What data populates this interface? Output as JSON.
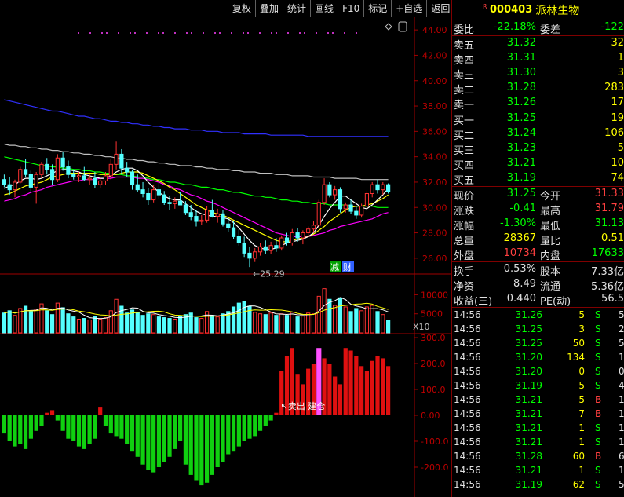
{
  "toolbar": [
    "复权",
    "叠加",
    "统计",
    "画线",
    "F10",
    "标记",
    "+自选",
    "返回"
  ],
  "stock": {
    "badge": "R",
    "code": "000403",
    "name": "派林生物"
  },
  "order_ratio": {
    "label": "委比",
    "value": "-22.18%",
    "label2": "委差",
    "value2": "-122"
  },
  "asks": [
    {
      "label": "卖五",
      "price": "31.32",
      "qty": "32"
    },
    {
      "label": "卖四",
      "price": "31.31",
      "qty": "1"
    },
    {
      "label": "卖三",
      "price": "31.30",
      "qty": "3"
    },
    {
      "label": "卖二",
      "price": "31.28",
      "qty": "283"
    },
    {
      "label": "卖一",
      "price": "31.26",
      "qty": "17"
    }
  ],
  "bids": [
    {
      "label": "买一",
      "price": "31.25",
      "qty": "19"
    },
    {
      "label": "买二",
      "price": "31.24",
      "qty": "106"
    },
    {
      "label": "买三",
      "price": "31.23",
      "qty": "5"
    },
    {
      "label": "买四",
      "price": "31.21",
      "qty": "10"
    },
    {
      "label": "买五",
      "price": "31.19",
      "qty": "74"
    }
  ],
  "quote": [
    {
      "l1": "现价",
      "v1": "31.25",
      "c1": "green",
      "l2": "今开",
      "v2": "31.33",
      "c2": "red"
    },
    {
      "l1": "涨跌",
      "v1": "-0.41",
      "c1": "green",
      "l2": "最高",
      "v2": "31.79",
      "c2": "red"
    },
    {
      "l1": "涨幅",
      "v1": "-1.30%",
      "c1": "green",
      "l2": "最低",
      "v2": "31.13",
      "c2": "green"
    },
    {
      "l1": "总量",
      "v1": "28367",
      "c1": "yellow",
      "l2": "量比",
      "v2": "0.51",
      "c2": "yellow"
    },
    {
      "l1": "外盘",
      "v1": "10734",
      "c1": "red",
      "l2": "内盘",
      "v2": "17633",
      "c2": "green"
    }
  ],
  "stats": [
    {
      "l1": "换手",
      "v1": "0.53%",
      "l2": "股本",
      "v2": "7.33亿"
    },
    {
      "l1": "净资",
      "v1": "8.49",
      "l2": "流通",
      "v2": "5.36亿"
    },
    {
      "l1": "收益(三)",
      "v1": "0.440",
      "l2": "PE(动)",
      "v2": "56.5"
    }
  ],
  "ticks": [
    {
      "time": "14:56",
      "price": "31.26",
      "vol": "5",
      "side": "S",
      "cnt": "5"
    },
    {
      "time": "14:56",
      "price": "31.25",
      "vol": "3",
      "side": "S",
      "cnt": "2"
    },
    {
      "time": "14:56",
      "price": "31.25",
      "vol": "50",
      "side": "S",
      "cnt": "5"
    },
    {
      "time": "14:56",
      "price": "31.20",
      "vol": "134",
      "side": "S",
      "cnt": "12"
    },
    {
      "time": "14:56",
      "price": "31.20",
      "vol": "0",
      "side": "S",
      "cnt": "0"
    },
    {
      "time": "14:56",
      "price": "31.19",
      "vol": "5",
      "side": "S",
      "cnt": "4"
    },
    {
      "time": "14:56",
      "price": "31.21",
      "vol": "5",
      "side": "B",
      "cnt": "1"
    },
    {
      "time": "14:56",
      "price": "31.21",
      "vol": "7",
      "side": "B",
      "cnt": "1"
    },
    {
      "time": "14:56",
      "price": "31.21",
      "vol": "1",
      "side": "S",
      "cnt": "1"
    },
    {
      "time": "14:56",
      "price": "31.21",
      "vol": "1",
      "side": "S",
      "cnt": "1"
    },
    {
      "time": "14:56",
      "price": "31.28",
      "vol": "60",
      "side": "B",
      "cnt": "6"
    },
    {
      "time": "14:56",
      "price": "31.21",
      "vol": "1",
      "side": "S",
      "cnt": "1"
    },
    {
      "time": "14:56",
      "price": "31.19",
      "vol": "62",
      "side": "S",
      "cnt": "5"
    }
  ],
  "chart_data": {
    "type": "candlestick",
    "price_axis": {
      "ticks": [
        "44.00",
        "42.00",
        "40.00",
        "38.00",
        "36.00",
        "34.00",
        "32.00",
        "30.00",
        "28.00",
        "26.00"
      ],
      "ylim": [
        25,
        45
      ]
    },
    "low_annotation": "25.29",
    "tags": [
      "减",
      "财"
    ],
    "volume_axis": {
      "ticks": [
        "10000",
        "5000"
      ],
      "unit": "X10",
      "ylim": [
        0,
        14000
      ]
    },
    "indicator_axis": {
      "ticks": [
        "300.0",
        "200.0",
        "100.0",
        "0.00",
        "-100.0",
        "-200.0"
      ],
      "ylim": [
        -300,
        300
      ]
    },
    "indicator_annotation": "卖出 建仓",
    "colors": {
      "up": "#ff3232",
      "down": "#54ffff",
      "ma5": "#ffffff",
      "ma10": "#ffff00",
      "ma20": "#ff00ff",
      "ma60": "#00ff00",
      "ma120": "#c0c0c0",
      "ma250": "#3030ff"
    },
    "candles": [
      [
        32.2,
        32.6,
        31.6,
        31.8
      ],
      [
        31.8,
        32.4,
        31.0,
        31.4
      ],
      [
        31.4,
        32.2,
        30.8,
        32.0
      ],
      [
        32.0,
        33.2,
        31.9,
        33.0
      ],
      [
        33.0,
        33.8,
        32.4,
        32.6
      ],
      [
        32.6,
        32.9,
        31.2,
        31.6
      ],
      [
        31.6,
        32.8,
        30.3,
        32.6
      ],
      [
        32.6,
        33.6,
        32.3,
        33.4
      ],
      [
        33.4,
        33.9,
        32.6,
        33.0
      ],
      [
        33.0,
        33.4,
        31.8,
        32.2
      ],
      [
        32.2,
        34.2,
        32.0,
        33.9
      ],
      [
        33.9,
        34.4,
        32.9,
        33.2
      ],
      [
        33.2,
        33.7,
        32.3,
        32.6
      ],
      [
        32.6,
        33.0,
        32.2,
        32.4
      ],
      [
        32.4,
        32.8,
        32.0,
        32.5
      ],
      [
        32.5,
        33.2,
        32.1,
        32.2
      ],
      [
        32.2,
        32.6,
        31.8,
        32.3
      ],
      [
        32.3,
        32.8,
        31.5,
        31.8
      ],
      [
        31.8,
        32.4,
        31.5,
        32.1
      ],
      [
        32.1,
        32.8,
        31.8,
        32.5
      ],
      [
        32.5,
        33.8,
        32.2,
        33.4
      ],
      [
        33.4,
        35.2,
        33.0,
        34.2
      ],
      [
        34.2,
        34.6,
        32.6,
        33.1
      ],
      [
        33.1,
        33.6,
        32.4,
        32.8
      ],
      [
        32.8,
        33.0,
        31.4,
        31.8
      ],
      [
        31.8,
        32.6,
        31.2,
        31.4
      ],
      [
        31.4,
        32.0,
        30.8,
        31.1
      ],
      [
        31.1,
        31.5,
        30.2,
        30.6
      ],
      [
        30.6,
        31.8,
        30.4,
        31.4
      ],
      [
        31.4,
        32.0,
        30.7,
        31.0
      ],
      [
        31.0,
        31.3,
        30.2,
        30.4
      ],
      [
        30.4,
        30.9,
        29.8,
        30.3
      ],
      [
        30.3,
        30.8,
        29.9,
        30.5
      ],
      [
        30.5,
        31.2,
        30.2,
        30.2
      ],
      [
        30.2,
        30.5,
        29.4,
        29.6
      ],
      [
        29.6,
        30.2,
        29.0,
        29.3
      ],
      [
        29.3,
        29.8,
        28.5,
        28.9
      ],
      [
        28.9,
        29.4,
        28.6,
        29.0
      ],
      [
        29.0,
        30.1,
        28.8,
        29.8
      ],
      [
        29.8,
        30.6,
        29.2,
        29.3
      ],
      [
        29.3,
        29.9,
        28.8,
        29.5
      ],
      [
        29.5,
        29.8,
        28.5,
        28.7
      ],
      [
        28.7,
        29.1,
        28.1,
        28.4
      ],
      [
        28.4,
        28.9,
        27.5,
        27.7
      ],
      [
        27.7,
        28.3,
        27.0,
        27.2
      ],
      [
        27.2,
        27.7,
        26.1,
        26.4
      ],
      [
        26.4,
        26.9,
        25.3,
        26.0
      ],
      [
        26.0,
        26.8,
        25.7,
        26.5
      ],
      [
        26.5,
        27.2,
        26.2,
        26.9
      ],
      [
        26.9,
        27.4,
        26.3,
        26.6
      ],
      [
        26.6,
        27.3,
        26.3,
        27.0
      ],
      [
        27.0,
        27.6,
        26.5,
        26.8
      ],
      [
        26.8,
        27.8,
        26.6,
        27.6
      ],
      [
        27.6,
        28.0,
        27.0,
        27.2
      ],
      [
        27.2,
        28.3,
        27.0,
        28.0
      ],
      [
        28.0,
        28.4,
        27.3,
        27.6
      ],
      [
        27.6,
        28.2,
        27.1,
        28.0
      ],
      [
        28.0,
        28.5,
        27.7,
        28.3
      ],
      [
        28.3,
        28.9,
        28.0,
        28.6
      ],
      [
        28.6,
        30.6,
        28.4,
        30.4
      ],
      [
        30.4,
        32.3,
        30.2,
        31.8
      ],
      [
        31.8,
        32.0,
        30.8,
        31.0
      ],
      [
        31.0,
        31.7,
        30.6,
        31.4
      ],
      [
        31.4,
        31.6,
        29.6,
        29.9
      ],
      [
        29.9,
        30.4,
        29.6,
        30.2
      ],
      [
        30.2,
        30.6,
        29.5,
        29.7
      ],
      [
        29.7,
        30.1,
        29.1,
        29.4
      ],
      [
        29.4,
        30.3,
        29.2,
        30.1
      ],
      [
        30.1,
        31.3,
        29.9,
        31.1
      ],
      [
        31.1,
        32.0,
        30.8,
        31.8
      ],
      [
        31.8,
        32.2,
        31.1,
        31.4
      ],
      [
        31.4,
        32.0,
        31.0,
        31.8
      ],
      [
        31.8,
        31.9,
        31.1,
        31.25
      ]
    ],
    "ma_lines": {
      "ma5": [
        31.5,
        31.7,
        31.8,
        32.1,
        32.3,
        32.3,
        32.2,
        32.3,
        32.5,
        32.7,
        32.9,
        33.0,
        33.0,
        32.9,
        32.8,
        32.6,
        32.5,
        32.4,
        32.3,
        32.3,
        32.5,
        32.8,
        33.0,
        33.1,
        33.1,
        32.9,
        32.5,
        32.0,
        31.6,
        31.2,
        30.9,
        30.7,
        30.6,
        30.6,
        30.3,
        30.0,
        29.7,
        29.5,
        29.4,
        29.3,
        29.3,
        29.2,
        29.1,
        28.8,
        28.4,
        27.9,
        27.4,
        27.0,
        26.8,
        26.7,
        26.7,
        26.8,
        27.0,
        27.2,
        27.3,
        27.4,
        27.5,
        27.7,
        28.0,
        28.6,
        29.3,
        29.9,
        30.4,
        30.9,
        30.9,
        30.6,
        30.3,
        30.0,
        29.9,
        30.2,
        30.6,
        31.0,
        31.5
      ],
      "ma10": [
        31.0,
        31.1,
        31.3,
        31.5,
        31.7,
        31.8,
        31.9,
        32.0,
        32.2,
        32.4,
        32.5,
        32.6,
        32.7,
        32.7,
        32.7,
        32.7,
        32.7,
        32.7,
        32.6,
        32.6,
        32.6,
        32.6,
        32.7,
        32.8,
        32.8,
        32.8,
        32.7,
        32.5,
        32.3,
        32.1,
        31.9,
        31.6,
        31.4,
        31.1,
        30.8,
        30.5,
        30.2,
        30.0,
        29.8,
        29.6,
        29.5,
        29.4,
        29.2,
        29.0,
        28.8,
        28.6,
        28.4,
        28.2,
        28.0,
        27.8,
        27.6,
        27.4,
        27.3,
        27.3,
        27.4,
        27.5,
        27.6,
        27.7,
        27.9,
        28.2,
        28.5,
        28.9,
        29.2,
        29.5,
        29.8,
        30.0,
        30.1,
        30.1,
        30.2,
        30.3,
        30.5,
        30.7,
        31.0
      ],
      "ma20": [
        30.5,
        30.6,
        30.7,
        30.9,
        31.0,
        31.2,
        31.3,
        31.4,
        31.6,
        31.7,
        31.8,
        31.9,
        32.0,
        32.1,
        32.1,
        32.2,
        32.2,
        32.2,
        32.3,
        32.3,
        32.3,
        32.4,
        32.4,
        32.4,
        32.4,
        32.3,
        32.3,
        32.2,
        32.1,
        32.0,
        31.8,
        31.7,
        31.5,
        31.4,
        31.2,
        31.0,
        30.9,
        30.7,
        30.5,
        30.4,
        30.2,
        30.0,
        29.8,
        29.6,
        29.4,
        29.2,
        29.0,
        28.8,
        28.6,
        28.4,
        28.2,
        28.0,
        27.9,
        27.8,
        27.7,
        27.7,
        27.7,
        27.7,
        27.8,
        27.9,
        28.0,
        28.2,
        28.3,
        28.5,
        28.6,
        28.7,
        28.8,
        28.9,
        29.0,
        29.1,
        29.3,
        29.5,
        29.6
      ],
      "ma60": [
        34.0,
        33.9,
        33.8,
        33.7,
        33.6,
        33.5,
        33.4,
        33.3,
        33.3,
        33.2,
        33.2,
        33.1,
        33.1,
        33.0,
        33.0,
        32.9,
        32.9,
        32.8,
        32.8,
        32.7,
        32.7,
        32.6,
        32.6,
        32.5,
        32.5,
        32.4,
        32.4,
        32.3,
        32.2,
        32.2,
        32.1,
        32.0,
        32.0,
        31.9,
        31.8,
        31.8,
        31.7,
        31.6,
        31.6,
        31.5,
        31.4,
        31.4,
        31.3,
        31.2,
        31.2,
        31.1,
        31.0,
        30.9,
        30.9,
        30.8,
        30.8,
        30.7,
        30.6,
        30.6,
        30.5,
        30.5,
        30.4,
        30.4,
        30.3,
        30.3,
        30.3,
        30.2,
        30.2,
        30.2,
        30.2,
        30.1,
        30.1,
        30.1,
        30.1,
        30.1,
        30.0,
        30.0,
        30.0
      ],
      "ma120": [
        35.0,
        34.9,
        34.9,
        34.8,
        34.8,
        34.7,
        34.7,
        34.6,
        34.6,
        34.5,
        34.5,
        34.4,
        34.4,
        34.3,
        34.3,
        34.2,
        34.2,
        34.1,
        34.1,
        34.0,
        34.0,
        33.9,
        33.9,
        33.8,
        33.8,
        33.7,
        33.7,
        33.6,
        33.6,
        33.5,
        33.5,
        33.4,
        33.4,
        33.3,
        33.3,
        33.3,
        33.2,
        33.2,
        33.1,
        33.1,
        33.0,
        33.0,
        33.0,
        32.9,
        32.9,
        32.8,
        32.8,
        32.8,
        32.7,
        32.7,
        32.7,
        32.6,
        32.6,
        32.6,
        32.5,
        32.5,
        32.5,
        32.5,
        32.4,
        32.4,
        32.4,
        32.4,
        32.3,
        32.3,
        32.3,
        32.3,
        32.3,
        32.2,
        32.2,
        32.2,
        32.2,
        32.2,
        32.2
      ],
      "ma250": [
        38.5,
        38.4,
        38.3,
        38.2,
        38.1,
        38.0,
        37.9,
        37.8,
        37.7,
        37.6,
        37.6,
        37.5,
        37.4,
        37.3,
        37.2,
        37.2,
        37.1,
        37.0,
        37.0,
        36.9,
        36.8,
        36.8,
        36.7,
        36.7,
        36.6,
        36.6,
        36.5,
        36.5,
        36.4,
        36.4,
        36.3,
        36.3,
        36.2,
        36.2,
        36.2,
        36.1,
        36.1,
        36.1,
        36.0,
        36.0,
        36.0,
        35.9,
        35.9,
        35.9,
        35.9,
        35.8,
        35.8,
        35.8,
        35.8,
        35.8,
        35.7,
        35.7,
        35.7,
        35.7,
        35.7,
        35.7,
        35.7,
        35.6,
        35.6,
        35.6,
        35.6,
        35.6,
        35.6,
        35.6,
        35.6,
        35.6,
        35.6,
        35.6,
        35.6,
        35.6,
        35.6,
        35.6,
        35.6
      ]
    },
    "volumes": [
      5200,
      5800,
      4600,
      6400,
      7000,
      5600,
      6200,
      7600,
      5800,
      4800,
      7800,
      6600,
      5000,
      4200,
      3600,
      3800,
      3400,
      4400,
      3600,
      4000,
      5800,
      8800,
      7000,
      5200,
      6000,
      5400,
      4600,
      5000,
      4800,
      4200,
      4000,
      3800,
      3600,
      4400,
      4800,
      5200,
      4000,
      3800,
      5600,
      4600,
      4200,
      5000,
      5600,
      6800,
      7800,
      8200,
      7000,
      5400,
      5000,
      4800,
      5200,
      4600,
      5000,
      4600,
      5400,
      4200,
      4400,
      5200,
      5000,
      9600,
      11600,
      8800,
      7200,
      9200,
      6800,
      5600,
      6400,
      5800,
      6800,
      7200,
      5600,
      4800,
      3200
    ],
    "indicator": [
      -70,
      -100,
      -120,
      -110,
      -130,
      -90,
      -60,
      -40,
      10,
      20,
      -20,
      -60,
      -90,
      -100,
      -120,
      -130,
      -110,
      -90,
      30,
      -40,
      -70,
      -80,
      -90,
      -110,
      -140,
      -160,
      -190,
      -210,
      -220,
      -200,
      -180,
      -160,
      -130,
      -100,
      -190,
      -230,
      -250,
      -270,
      -260,
      -230,
      -200,
      -180,
      -150,
      -140,
      -120,
      -100,
      -90,
      -80,
      -60,
      -40,
      -20,
      10,
      170,
      230,
      260,
      160,
      120,
      180,
      200,
      210,
      220,
      200,
      150,
      120,
      260,
      250,
      230,
      190,
      170,
      210,
      230,
      220,
      190
    ],
    "indicator_spike": {
      "index": 20,
      "value": 260
    }
  }
}
